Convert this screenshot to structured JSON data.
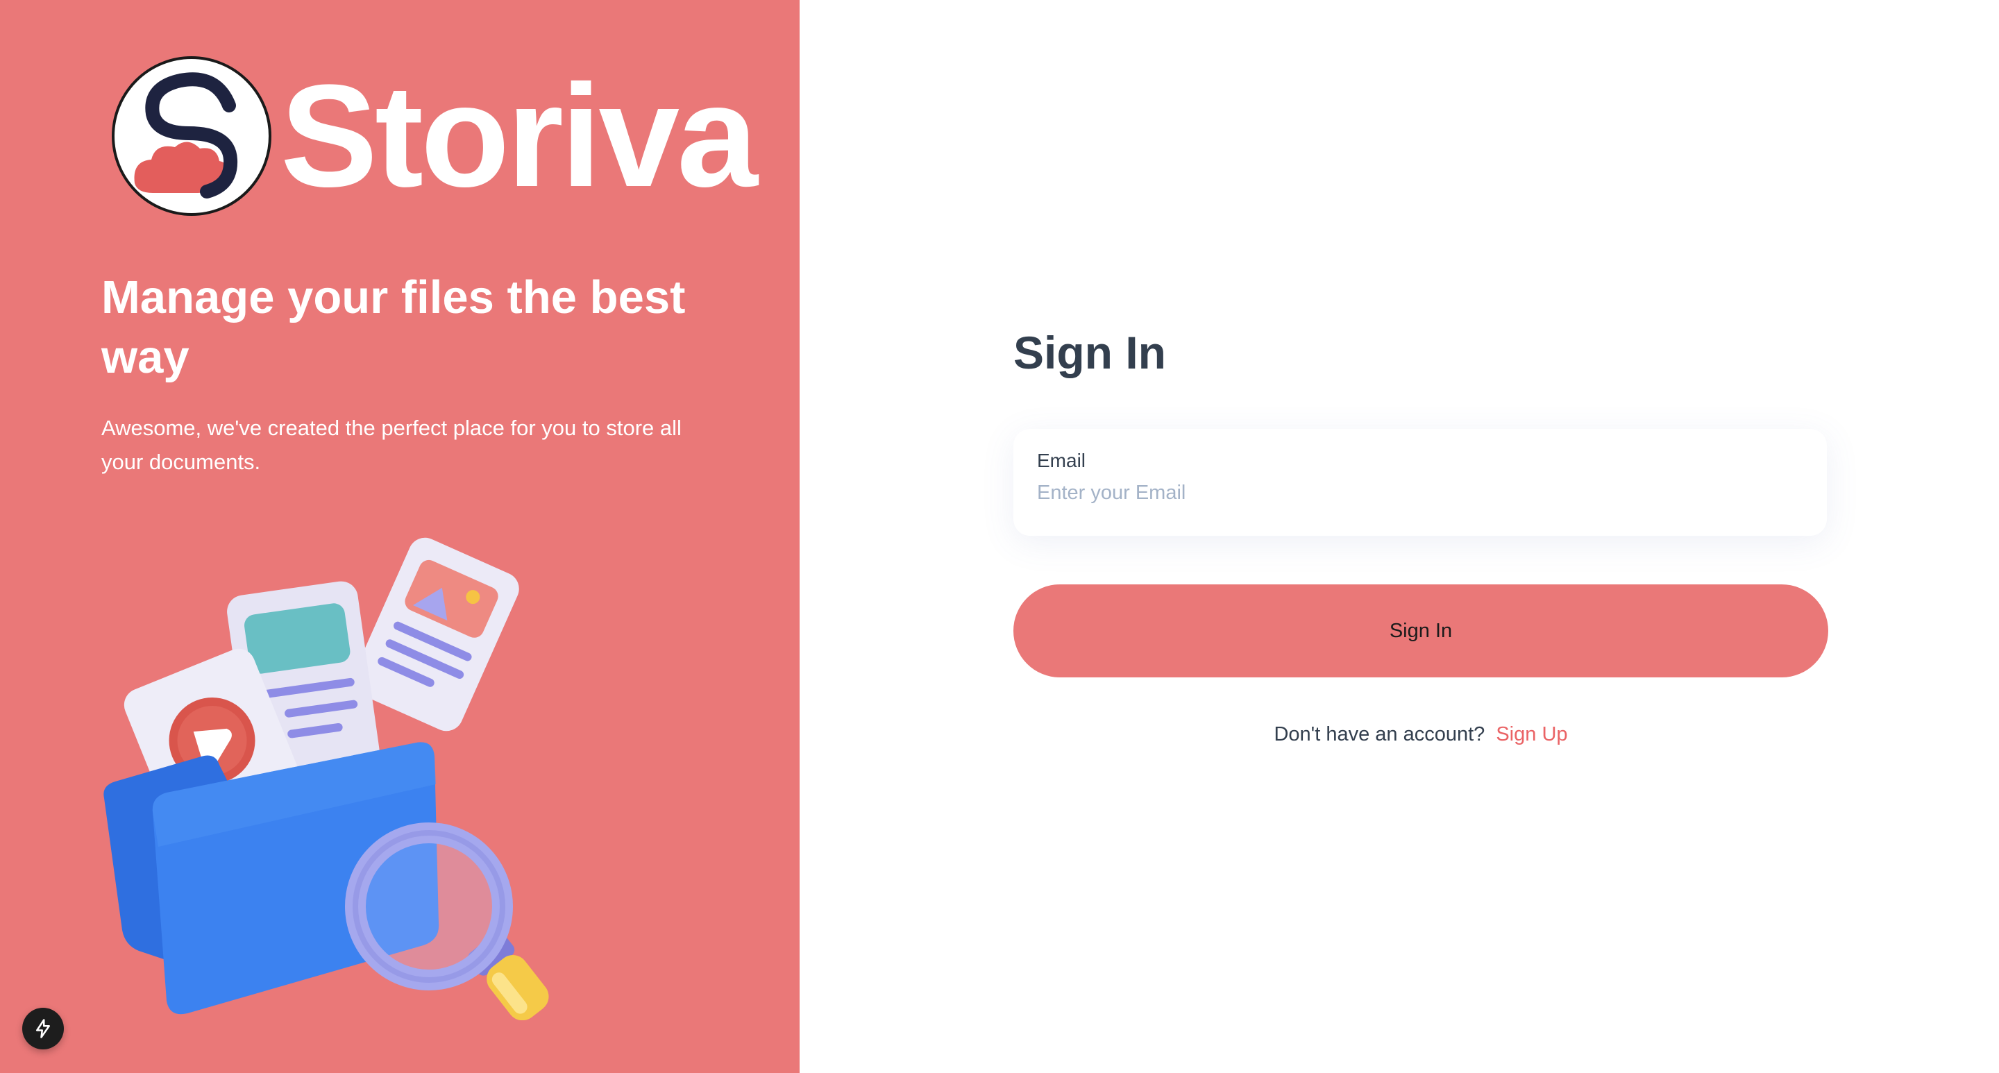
{
  "brand": {
    "name": "Storiva",
    "logo_icon": "storiva-logo-icon",
    "tagline": "Manage your files the best way",
    "description": "Awesome, we've created the perfect place for you to store all your documents.",
    "illustration_icon": "folder-files-magnifier-illustration",
    "panel_color": "#EA7878"
  },
  "dev_badge": {
    "icon": "lightning-icon"
  },
  "form": {
    "title": "Sign In",
    "email": {
      "label": "Email",
      "placeholder": "Enter your Email",
      "value": ""
    },
    "submit_label": "Sign In",
    "signup_prompt": "Don't have an account?",
    "signup_link": "Sign Up",
    "accent_color": "#EA6365",
    "text_color": "#333F4E"
  }
}
